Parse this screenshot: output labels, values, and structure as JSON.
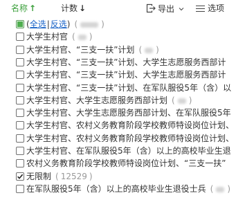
{
  "header": {
    "sort_name": {
      "label": "名称",
      "arrow": "↑",
      "active": true
    },
    "sort_count": {
      "label": "计数",
      "arrow": "↓"
    },
    "export": {
      "label": "导出",
      "icon": "export-icon",
      "chevron_icon": "chevron-down-icon"
    },
    "options": {
      "label": "选项",
      "icon": "menu-icon"
    }
  },
  "select_all": {
    "state": "indeterminate",
    "paren_open": "(",
    "select_all_label": "全选",
    "separator": "|",
    "invert_label": "反选",
    "paren_close": ")",
    "count_obscured": true
  },
  "count_paren_open": "(",
  "count_paren_close": ")",
  "items": [
    {
      "label": "大学生村官",
      "checked": false,
      "count_obscured": true
    },
    {
      "label": "大学生村官、“三支一扶”计划",
      "checked": false,
      "count_obscured": true
    },
    {
      "label": "大学生村官、“三支一扶”计划、大学生志愿服务西部计",
      "checked": false
    },
    {
      "label": "大学生村官、“三支一扶”计划、大学生志愿服务西部计",
      "checked": false
    },
    {
      "label": "大学生村官、“三支一扶”计划、在军队服役5年（含）以",
      "checked": false
    },
    {
      "label": "大学生村官、大学生志愿服务西部计划",
      "checked": false,
      "count_obscured": true
    },
    {
      "label": "大学生村官、大学生志愿服务西部计划、在军队服役5年",
      "checked": false
    },
    {
      "label": "大学生村官、农村义务教育阶段学校教师特设岗位计划、",
      "checked": false
    },
    {
      "label": "大学生村官、农村义务教育阶段学校教师特设岗位计划、",
      "checked": false
    },
    {
      "label": "大学生村官、在军队服役5年（含）以上的高校毕业生退",
      "checked": false
    },
    {
      "label": "农村义务教育阶段学校教师特设岗位计划、“三支一扶”",
      "checked": false
    },
    {
      "label": "无限制",
      "checked": true,
      "count": "12529"
    },
    {
      "label": "在军队服役5年（含）以上的高校毕业生退役士兵",
      "checked": false,
      "count_obscured": true
    }
  ],
  "colors": {
    "accent_green": "#3ca03c",
    "link_blue": "#1a64c8",
    "text": "#333333",
    "count_gray": "#999999"
  }
}
